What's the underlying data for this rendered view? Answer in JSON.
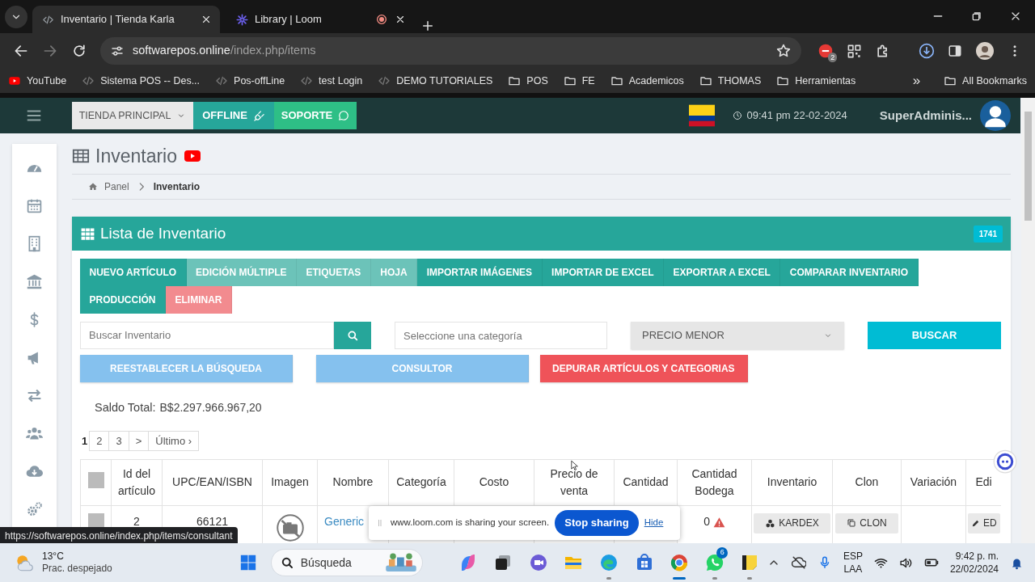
{
  "browser": {
    "tabs": [
      {
        "title": "Inventario | Tienda Karla",
        "selected": true,
        "recording": false,
        "kind": "code"
      },
      {
        "title": "Library | Loom",
        "selected": false,
        "recording": true,
        "kind": "burst"
      }
    ],
    "address": {
      "domain": "softwarepos.online",
      "path": "/index.php/items"
    },
    "extension_badge": "2",
    "bookmarks": [
      {
        "label": "YouTube",
        "kind": "video"
      },
      {
        "label": "Sistema POS -- Des...",
        "kind": "page"
      },
      {
        "label": "Pos-offLine",
        "kind": "page"
      },
      {
        "label": "test Login",
        "kind": "page"
      },
      {
        "label": "DEMO TUTORIALES",
        "kind": "page"
      },
      {
        "label": "POS",
        "kind": "folder"
      },
      {
        "label": "FE",
        "kind": "folder"
      },
      {
        "label": "Academicos",
        "kind": "folder"
      },
      {
        "label": "THOMAS",
        "kind": "folder"
      },
      {
        "label": "Herramientas",
        "kind": "folder"
      }
    ],
    "bookmarks_overflow": "»",
    "all_bookmarks": "All Bookmarks"
  },
  "app_header": {
    "store": "TIENDA PRINCIPAL",
    "offline": "OFFLINE",
    "support": "SOPORTE",
    "clock": "09:41 pm 22-02-2024",
    "user": "SuperAdminis..."
  },
  "sidebar": {
    "items": [
      {
        "kind": "gauge"
      },
      {
        "kind": "calendar"
      },
      {
        "kind": "building"
      },
      {
        "kind": "bank"
      },
      {
        "kind": "dollar"
      },
      {
        "kind": "megaphone"
      },
      {
        "kind": "exchange"
      },
      {
        "kind": "users"
      },
      {
        "kind": "cloud"
      },
      {
        "kind": "gears"
      }
    ]
  },
  "page": {
    "title": "Inventario",
    "breadcrumb": [
      {
        "label": "Panel",
        "current": false
      },
      {
        "label": "Inventario",
        "current": true
      }
    ]
  },
  "panel": {
    "title": "Lista de Inventario",
    "count": "1741",
    "actions": [
      {
        "label": "NUEVO ARTÍCULO",
        "kind": "primary"
      },
      {
        "label": "EDICIÓN MÚLTIPLE",
        "kind": "secondary"
      },
      {
        "label": "ETIQUETAS",
        "kind": "secondary"
      },
      {
        "label": "HOJA",
        "kind": "secondary"
      },
      {
        "label": "IMPORTAR IMÁGENES",
        "kind": "primary"
      },
      {
        "label": "IMPORTAR DE EXCEL",
        "kind": "primary"
      },
      {
        "label": "EXPORTAR A EXCEL",
        "kind": "primary"
      },
      {
        "label": "COMPARAR INVENTARIO",
        "kind": "primary"
      },
      {
        "label": "PRODUCCIÓN",
        "kind": "primary"
      },
      {
        "label": "ELIMINAR",
        "kind": "delete"
      }
    ],
    "search": {
      "placeholder": "Buscar Inventario"
    },
    "category": {
      "placeholder": "Seleccione una categoría"
    },
    "sort": {
      "value": "PRECIO MENOR"
    },
    "search_button": "BUSCAR",
    "tools": [
      {
        "label": "REESTABLECER LA BÚSQUEDA",
        "kind": "info"
      },
      {
        "label": "CONSULTOR",
        "kind": "info"
      },
      {
        "label": "DEPURAR ARTÍCULOS Y CATEGORIAS",
        "kind": "danger"
      }
    ],
    "balance": {
      "label": "Saldo Total:",
      "value": "B$2.297.966.967,20"
    },
    "pagination": [
      {
        "label": "1",
        "selected": true
      },
      {
        "label": "2",
        "selected": false
      },
      {
        "label": "3",
        "selected": false
      },
      {
        "label": ">",
        "selected": false
      },
      {
        "label": "Último ›",
        "selected": false
      }
    ],
    "table": {
      "columns": [
        {
          "kind": "checkbox",
          "checked": false
        },
        {
          "kind": "text",
          "label": "Id del artículo"
        },
        {
          "kind": "text",
          "label": "UPC/EAN/ISBN"
        },
        {
          "kind": "text",
          "label": "Imagen"
        },
        {
          "kind": "text",
          "label": "Nombre"
        },
        {
          "kind": "text",
          "label": "Categoría"
        },
        {
          "kind": "text",
          "label": "Costo"
        },
        {
          "kind": "text",
          "label": "Precio de venta"
        },
        {
          "kind": "text",
          "label": "Cantidad"
        },
        {
          "kind": "text",
          "label": "Cantidad Bodega"
        },
        {
          "kind": "text",
          "label": "Inventario"
        },
        {
          "kind": "text",
          "label": "Clon"
        },
        {
          "kind": "text",
          "label": "Variación"
        },
        {
          "kind": "text",
          "label": "Edi"
        }
      ],
      "rows": [
        {
          "checked": false,
          "id": "2",
          "upc": "66121",
          "image": {
            "kind": "missing"
          },
          "name": "Generic",
          "warehouse_qty": "0",
          "warning": true,
          "kardex": "KARDEX",
          "clone": "CLON",
          "edit": "ED"
        }
      ]
    }
  },
  "status_url": "https://softwarepos.online/index.php/items/consultant",
  "share_bar": {
    "message": "www.loom.com is sharing your screen.",
    "stop": "Stop sharing",
    "hide": "Hide"
  },
  "taskbar": {
    "weather": {
      "temp": "13°C",
      "sky": "Prac. despejado"
    },
    "search": "Búsqueda",
    "apps": [
      {
        "kind": "spark",
        "running": false,
        "selected": false
      },
      {
        "kind": "stack",
        "running": false,
        "selected": false
      },
      {
        "kind": "video",
        "running": false,
        "selected": false
      },
      {
        "kind": "folder",
        "running": false,
        "selected": false
      },
      {
        "kind": "wave",
        "running": true,
        "selected": false
      },
      {
        "kind": "bag",
        "running": false,
        "selected": false
      },
      {
        "kind": "ring",
        "running": true,
        "selected": true
      },
      {
        "kind": "phone",
        "running": true,
        "selected": false,
        "badge": "6"
      },
      {
        "kind": "note",
        "running": true,
        "selected": false
      }
    ],
    "tray": {
      "lang": "ESP",
      "layout": "LAA",
      "time": "9:42 p. m.",
      "date": "22/02/2024"
    }
  }
}
